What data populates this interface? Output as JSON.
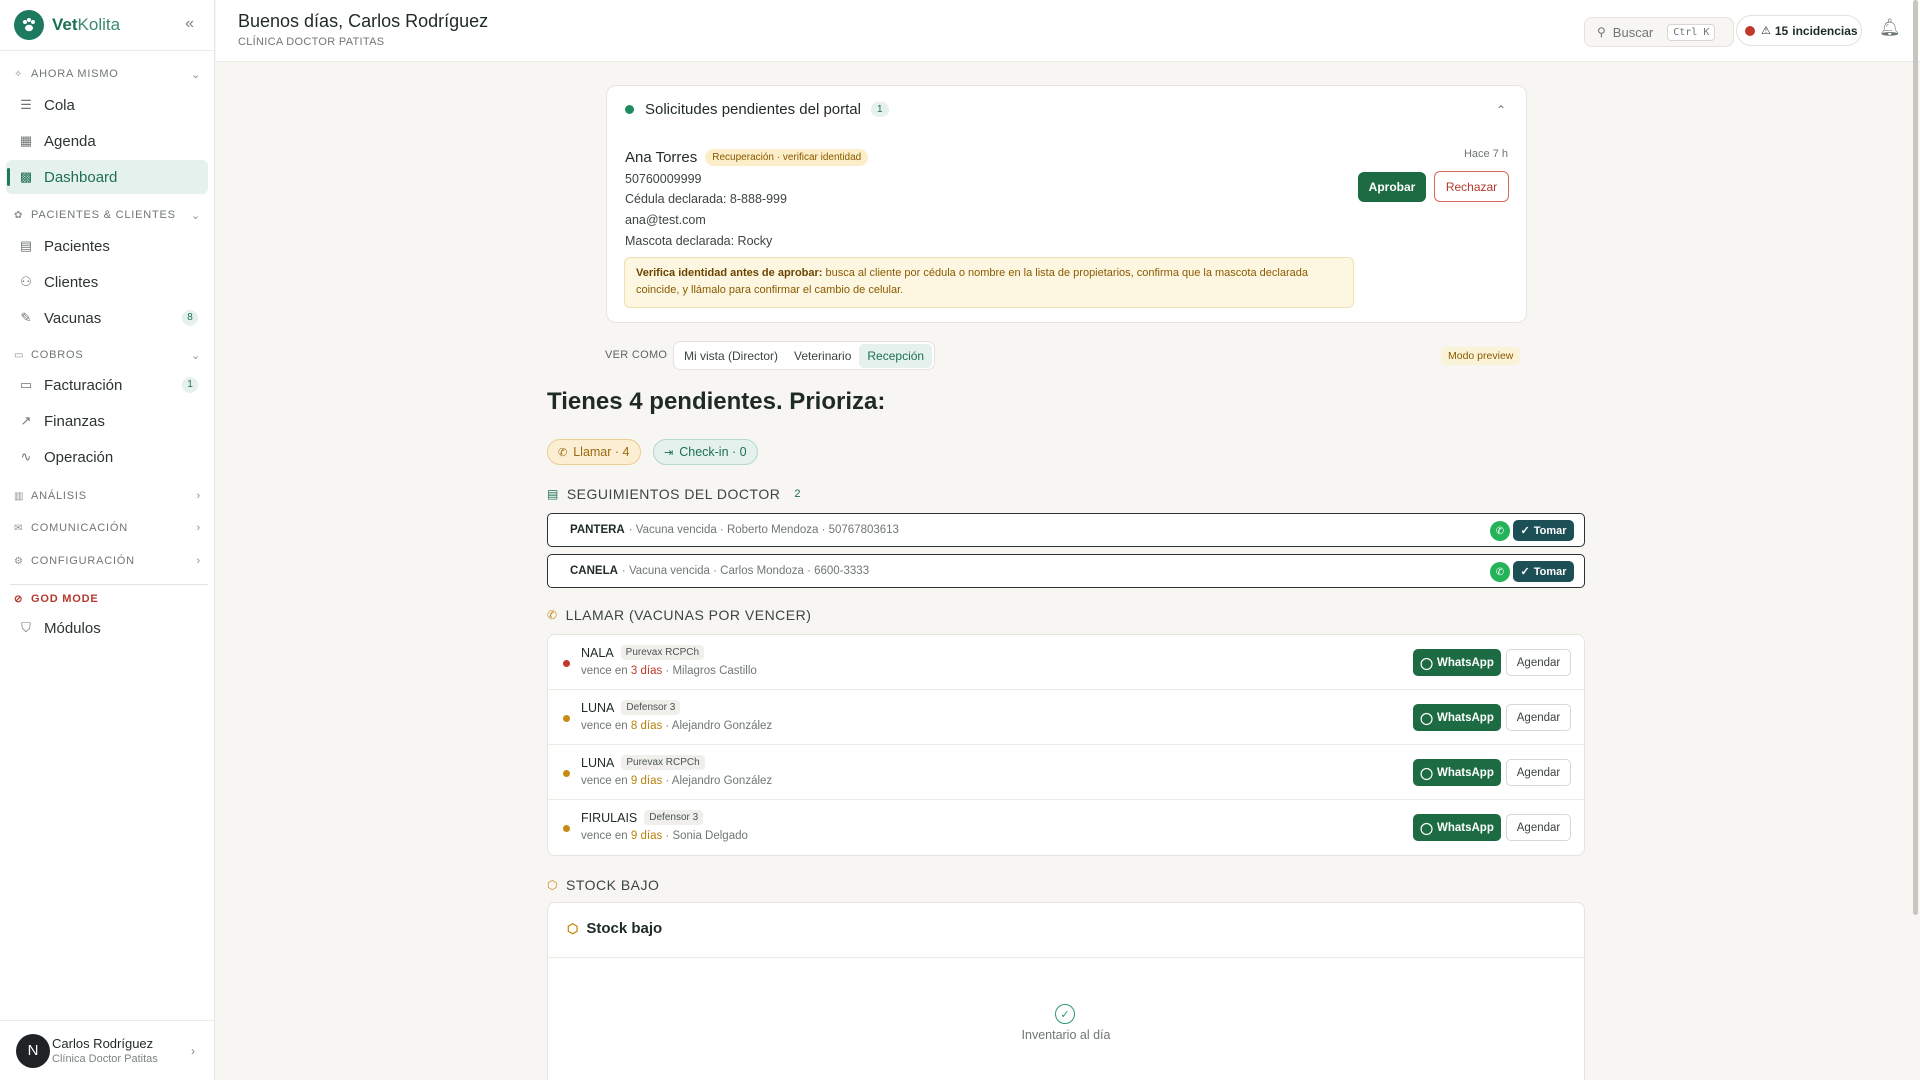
{
  "brand": {
    "name_bold": "Vet",
    "name_light": "Kolita"
  },
  "sidebar": {
    "groups": {
      "ahora": "AHORA MISMO",
      "pacientes": "PACIENTES & CLIENTES",
      "cobros": "COBROS",
      "analisis": "ANÁLISIS",
      "comunicacion": "COMUNICACIÓN",
      "configuracion": "CONFIGURACIÓN",
      "god": "GOD MODE"
    },
    "items": {
      "cola": "Cola",
      "agenda": "Agenda",
      "dashboard": "Dashboard",
      "pacientes": "Pacientes",
      "clientes": "Clientes",
      "vacunas": "Vacunas",
      "vacunas_badge": "8",
      "facturacion": "Facturación",
      "facturacion_badge": "1",
      "finanzas": "Finanzas",
      "operacion": "Operación",
      "modulos": "Módulos"
    },
    "active_item": "Dashboard",
    "user": {
      "initial": "N",
      "name": "Carlos Rodríguez",
      "clinic": "Clínica Doctor Patitas"
    }
  },
  "header": {
    "greeting": "Buenos días, Carlos Rodríguez",
    "clinic": "CLÍNICA DOCTOR PATITAS",
    "search_label": "Buscar",
    "shortcut": "Ctrl K",
    "incidents_count": "15",
    "incidents_label": "incidencias"
  },
  "portal": {
    "title": "Solicitudes pendientes del portal",
    "count": "1",
    "request": {
      "name": "Ana Torres",
      "tag": "Recuperación · verificar identidad",
      "phone": "50760009999",
      "cedula": "Cédula declarada: 8-888-999",
      "email": "ana@test.com",
      "mascota": "Mascota declarada: Rocky",
      "time": "Hace 7 h",
      "approve": "Aprobar",
      "reject": "Rechazar",
      "warning_bold": "Verifica identidad antes de aprobar:",
      "warning_text": "busca al cliente por cédula o nombre en la lista de propietarios, confirma que la mascota declarada coincide, y llámalo para confirmar el cambio de celular."
    }
  },
  "view": {
    "label": "VER COMO",
    "options": [
      "Mi vista (Director)",
      "Veterinario",
      "Recepción"
    ],
    "selected": "Recepción",
    "preview_badge": "Modo preview"
  },
  "summary": {
    "heading": "Tienes 4 pendientes. Prioriza:",
    "pill_call": "Llamar · 4",
    "pill_checkin": "Check-in · 0"
  },
  "followups": {
    "title": "SEGUIMIENTOS DEL DOCTOR",
    "count": "2",
    "take_label": "Tomar",
    "rows": [
      {
        "pet": "PANTERA",
        "detail": "· Vacuna vencida · Roberto Mendoza · 50767803613"
      },
      {
        "pet": "CANELA",
        "detail": "· Vacuna vencida · Carlos Mondoza · 6600-3333"
      }
    ]
  },
  "calls": {
    "title": "LLAMAR (VACUNAS POR VENCER)",
    "whatsapp_label": "WhatsApp",
    "schedule_label": "Agendar",
    "rows": [
      {
        "pet": "NALA",
        "vaccine": "Purevax RCPCh",
        "prefix": "vence en",
        "days": "3 días",
        "owner": "· Milagros Castillo",
        "urgency": "red"
      },
      {
        "pet": "LUNA",
        "vaccine": "Defensor 3",
        "prefix": "vence en",
        "days": "8 días",
        "owner": "· Alejandro González",
        "urgency": "amber"
      },
      {
        "pet": "LUNA",
        "vaccine": "Purevax RCPCh",
        "prefix": "vence en",
        "days": "9 días",
        "owner": "· Alejandro González",
        "urgency": "amber"
      },
      {
        "pet": "FIRULAIS",
        "vaccine": "Defensor 3",
        "prefix": "vence en",
        "days": "9 días",
        "owner": "· Sonia Delgado",
        "urgency": "amber"
      }
    ]
  },
  "stock": {
    "section_title": "STOCK BAJO",
    "card_title": "Stock bajo",
    "empty_text": "Inventario al día"
  },
  "colors": {
    "brand": "#1d7a5f",
    "approve": "#1d6b43",
    "danger": "#c0392b",
    "warning": "#b7830f"
  }
}
